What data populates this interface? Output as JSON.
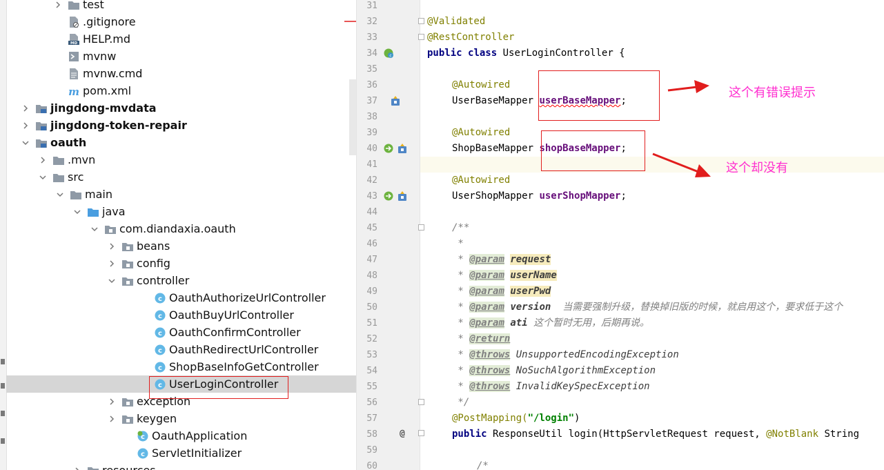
{
  "tree": {
    "items": [
      {
        "label": "test",
        "icon": "folder-icon",
        "bold": false
      },
      {
        "label": ".gitignore",
        "icon": "gitignore-file-icon",
        "bold": false
      },
      {
        "label": "HELP.md",
        "icon": "markdown-file-icon",
        "bold": false
      },
      {
        "label": "mvnw",
        "icon": "shell-file-icon",
        "bold": false
      },
      {
        "label": "mvnw.cmd",
        "icon": "text-file-icon",
        "bold": false
      },
      {
        "label": "pom.xml",
        "icon": "maven-file-icon",
        "bold": false
      },
      {
        "label": "jingdong-mvdata",
        "icon": "module-folder-icon",
        "bold": true
      },
      {
        "label": "jingdong-token-repair",
        "icon": "module-folder-icon",
        "bold": true
      },
      {
        "label": "oauth",
        "icon": "module-folder-icon",
        "bold": true
      },
      {
        "label": ".mvn",
        "icon": "folder-icon",
        "bold": false
      },
      {
        "label": "src",
        "icon": "folder-icon",
        "bold": false
      },
      {
        "label": "main",
        "icon": "folder-icon",
        "bold": false
      },
      {
        "label": "java",
        "icon": "source-folder-icon",
        "bold": false
      },
      {
        "label": "com.diandaxia.oauth",
        "icon": "package-icon",
        "bold": false
      },
      {
        "label": "beans",
        "icon": "package-icon",
        "bold": false
      },
      {
        "label": "config",
        "icon": "package-icon",
        "bold": false
      },
      {
        "label": "controller",
        "icon": "package-icon",
        "bold": false
      },
      {
        "label": "OauthAuthorizeUrlController",
        "icon": "java-class-icon",
        "bold": false
      },
      {
        "label": "OauthBuyUrlController",
        "icon": "java-class-icon",
        "bold": false
      },
      {
        "label": "OauthConfirmController",
        "icon": "java-class-icon",
        "bold": false
      },
      {
        "label": "OauthRedirectUrlController",
        "icon": "java-class-icon",
        "bold": false
      },
      {
        "label": "ShopBaseInfoGetController",
        "icon": "java-class-icon",
        "bold": false
      },
      {
        "label": "UserLoginController",
        "icon": "java-class-icon",
        "bold": false
      },
      {
        "label": "exception",
        "icon": "package-icon",
        "bold": false
      },
      {
        "label": "keygen",
        "icon": "package-icon",
        "bold": false
      },
      {
        "label": "OauthApplication",
        "icon": "spring-boot-class-icon",
        "bold": false
      },
      {
        "label": "ServletInitializer",
        "icon": "java-class-icon",
        "bold": false
      },
      {
        "label": "resources",
        "icon": "resources-folder-icon",
        "bold": false
      }
    ]
  },
  "editor": {
    "line_numbers": [
      "31",
      "32",
      "33",
      "34",
      "35",
      "36",
      "37",
      "38",
      "39",
      "40",
      "41",
      "42",
      "43",
      "44",
      "45",
      "46",
      "47",
      "48",
      "49",
      "50",
      "51",
      "52",
      "53",
      "54",
      "55",
      "56",
      "57",
      "58",
      "59",
      "60"
    ],
    "code": {
      "l32": "@Validated",
      "l33": "@RestController",
      "l34_kw1": "public",
      "l34_kw2": "class",
      "l34_rest": " UserLoginController {",
      "autowired": "@Autowired",
      "l37_type": "UserBaseMapper ",
      "l37_field": "userBaseMapper",
      "l40_type": "ShopBaseMapper ",
      "l40_field": "shopBaseMapper",
      "l43_type": "UserShopMapper ",
      "l43_field": "userShopMapper",
      "semicolon": ";",
      "l45": "/**",
      "l46": " *",
      "star": " * ",
      "param": "@param",
      "p_request": "request",
      "p_userName": "userName",
      "p_userPwd": "userPwd",
      "p_version": "version",
      "p_version_note": "当需要强制升级，替换掉旧版的时候，就启用这个，要求低于这个",
      "p_ati": "ati",
      "p_ati_note": "这个暂时无用，后期再说。",
      "return_tag": "@return",
      "throws_tag": "@throws",
      "ex1": "UnsupportedEncodingException",
      "ex2": "NoSuchAlgorithmException",
      "ex3": "InvalidKeySpecException",
      "l56": " */",
      "l57_anno": "@PostMapping(",
      "l57_str": "\"/login\"",
      "l57_end": ")",
      "l58_kw": "public",
      "l58_rest": " ResponseUtil login(HttpServletRequest request, ",
      "l58_anno": "@NotBlank",
      "l58_tail": " String",
      "l60": "/*",
      "at_marker": "@"
    }
  },
  "annotations": {
    "note1": "这个有错误提示",
    "note2": "这个却没有"
  },
  "colors": {
    "annotation_red": "#e11d1d",
    "annotation_text": "#ff2fd0",
    "keyword": "#000080",
    "annotation_code": "#808000",
    "field": "#660e7a"
  }
}
